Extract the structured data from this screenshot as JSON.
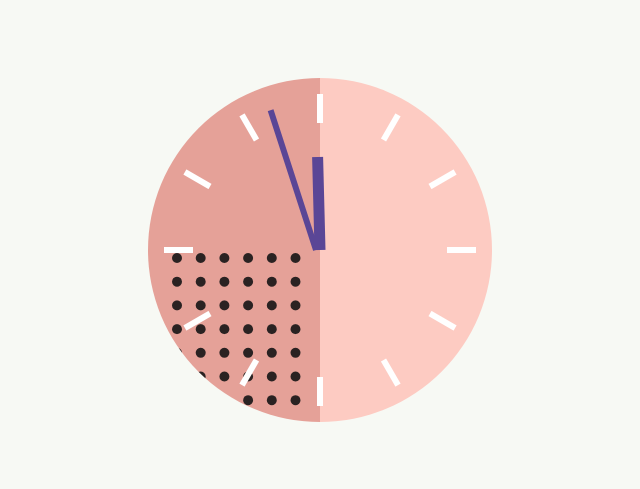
{
  "clock": {
    "hour": 11,
    "minute": 57,
    "tick_count": 12,
    "colors": {
      "background": "#f7f9f4",
      "face_right": "#fdcbc2",
      "face_left": "#e5a198",
      "dot": "#2a2222",
      "tick": "#ffffff",
      "hands": "#5a4696"
    },
    "dot_pattern_quadrant": "bottom-left"
  }
}
